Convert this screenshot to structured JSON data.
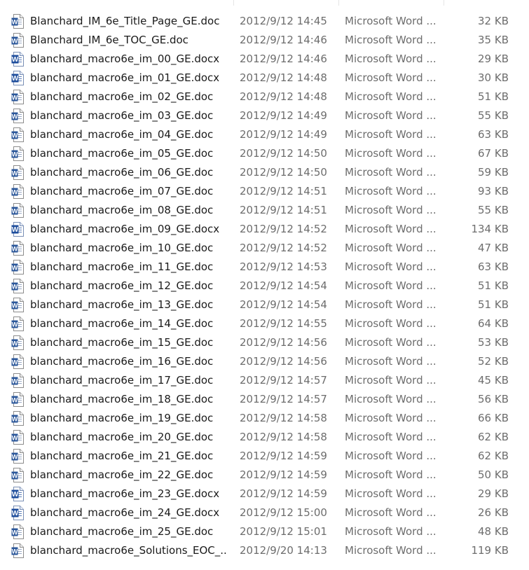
{
  "files": [
    {
      "name": "Blanchard_IM_6e_Title_Page_GE.doc",
      "date": "2012/9/12 14:45",
      "type": "Microsoft Word ...",
      "size": "32 KB",
      "icon": "word-doc-icon"
    },
    {
      "name": "Blanchard_IM_6e_TOC_GE.doc",
      "date": "2012/9/12 14:46",
      "type": "Microsoft Word ...",
      "size": "35 KB",
      "icon": "word-doc-icon"
    },
    {
      "name": "blanchard_macro6e_im_00_GE.docx",
      "date": "2012/9/12 14:46",
      "type": "Microsoft Word ...",
      "size": "29 KB",
      "icon": "word-docx-icon"
    },
    {
      "name": "blanchard_macro6e_im_01_GE.docx",
      "date": "2012/9/12 14:48",
      "type": "Microsoft Word ...",
      "size": "30 KB",
      "icon": "word-docx-icon"
    },
    {
      "name": "blanchard_macro6e_im_02_GE.doc",
      "date": "2012/9/12 14:48",
      "type": "Microsoft Word ...",
      "size": "51 KB",
      "icon": "word-doc-icon"
    },
    {
      "name": "blanchard_macro6e_im_03_GE.doc",
      "date": "2012/9/12 14:49",
      "type": "Microsoft Word ...",
      "size": "55 KB",
      "icon": "word-doc-icon"
    },
    {
      "name": "blanchard_macro6e_im_04_GE.doc",
      "date": "2012/9/12 14:49",
      "type": "Microsoft Word ...",
      "size": "63 KB",
      "icon": "word-doc-icon"
    },
    {
      "name": "blanchard_macro6e_im_05_GE.doc",
      "date": "2012/9/12 14:50",
      "type": "Microsoft Word ...",
      "size": "67 KB",
      "icon": "word-doc-icon"
    },
    {
      "name": "blanchard_macro6e_im_06_GE.doc",
      "date": "2012/9/12 14:50",
      "type": "Microsoft Word ...",
      "size": "59 KB",
      "icon": "word-doc-icon"
    },
    {
      "name": "blanchard_macro6e_im_07_GE.doc",
      "date": "2012/9/12 14:51",
      "type": "Microsoft Word ...",
      "size": "93 KB",
      "icon": "word-doc-icon"
    },
    {
      "name": "blanchard_macro6e_im_08_GE.doc",
      "date": "2012/9/12 14:51",
      "type": "Microsoft Word ...",
      "size": "55 KB",
      "icon": "word-doc-icon"
    },
    {
      "name": "blanchard_macro6e_im_09_GE.docx",
      "date": "2012/9/12 14:52",
      "type": "Microsoft Word ...",
      "size": "134 KB",
      "icon": "word-docx-icon"
    },
    {
      "name": "blanchard_macro6e_im_10_GE.doc",
      "date": "2012/9/12 14:52",
      "type": "Microsoft Word ...",
      "size": "47 KB",
      "icon": "word-doc-icon"
    },
    {
      "name": "blanchard_macro6e_im_11_GE.doc",
      "date": "2012/9/12 14:53",
      "type": "Microsoft Word ...",
      "size": "63 KB",
      "icon": "word-doc-icon"
    },
    {
      "name": "blanchard_macro6e_im_12_GE.doc",
      "date": "2012/9/12 14:54",
      "type": "Microsoft Word ...",
      "size": "51 KB",
      "icon": "word-doc-icon"
    },
    {
      "name": "blanchard_macro6e_im_13_GE.doc",
      "date": "2012/9/12 14:54",
      "type": "Microsoft Word ...",
      "size": "51 KB",
      "icon": "word-doc-icon"
    },
    {
      "name": "blanchard_macro6e_im_14_GE.doc",
      "date": "2012/9/12 14:55",
      "type": "Microsoft Word ...",
      "size": "64 KB",
      "icon": "word-doc-icon"
    },
    {
      "name": "blanchard_macro6e_im_15_GE.doc",
      "date": "2012/9/12 14:56",
      "type": "Microsoft Word ...",
      "size": "53 KB",
      "icon": "word-doc-icon"
    },
    {
      "name": "blanchard_macro6e_im_16_GE.doc",
      "date": "2012/9/12 14:56",
      "type": "Microsoft Word ...",
      "size": "52 KB",
      "icon": "word-doc-icon"
    },
    {
      "name": "blanchard_macro6e_im_17_GE.doc",
      "date": "2012/9/12 14:57",
      "type": "Microsoft Word ...",
      "size": "45 KB",
      "icon": "word-doc-icon"
    },
    {
      "name": "blanchard_macro6e_im_18_GE.doc",
      "date": "2012/9/12 14:57",
      "type": "Microsoft Word ...",
      "size": "56 KB",
      "icon": "word-doc-icon"
    },
    {
      "name": "blanchard_macro6e_im_19_GE.doc",
      "date": "2012/9/12 14:58",
      "type": "Microsoft Word ...",
      "size": "66 KB",
      "icon": "word-doc-icon"
    },
    {
      "name": "blanchard_macro6e_im_20_GE.doc",
      "date": "2012/9/12 14:58",
      "type": "Microsoft Word ...",
      "size": "62 KB",
      "icon": "word-doc-icon"
    },
    {
      "name": "blanchard_macro6e_im_21_GE.doc",
      "date": "2012/9/12 14:59",
      "type": "Microsoft Word ...",
      "size": "62 KB",
      "icon": "word-doc-icon"
    },
    {
      "name": "blanchard_macro6e_im_22_GE.doc",
      "date": "2012/9/12 14:59",
      "type": "Microsoft Word ...",
      "size": "50 KB",
      "icon": "word-doc-icon"
    },
    {
      "name": "blanchard_macro6e_im_23_GE.docx",
      "date": "2012/9/12 14:59",
      "type": "Microsoft Word ...",
      "size": "29 KB",
      "icon": "word-docx-icon"
    },
    {
      "name": "blanchard_macro6e_im_24_GE.docx",
      "date": "2012/9/12 15:00",
      "type": "Microsoft Word ...",
      "size": "26 KB",
      "icon": "word-docx-icon"
    },
    {
      "name": "blanchard_macro6e_im_25_GE.doc",
      "date": "2012/9/12 15:01",
      "type": "Microsoft Word ...",
      "size": "48 KB",
      "icon": "word-doc-icon"
    },
    {
      "name": "blanchard_macro6e_Solutions_EOC_...",
      "date": "2012/9/20 14:13",
      "type": "Microsoft Word ...",
      "size": "119 KB",
      "icon": "word-doc-icon"
    }
  ],
  "colors": {
    "text": "#1a1a1a",
    "meta_text": "#6d6d6d",
    "word_blue": "#2b579a",
    "hover": "#e5f3ff"
  }
}
